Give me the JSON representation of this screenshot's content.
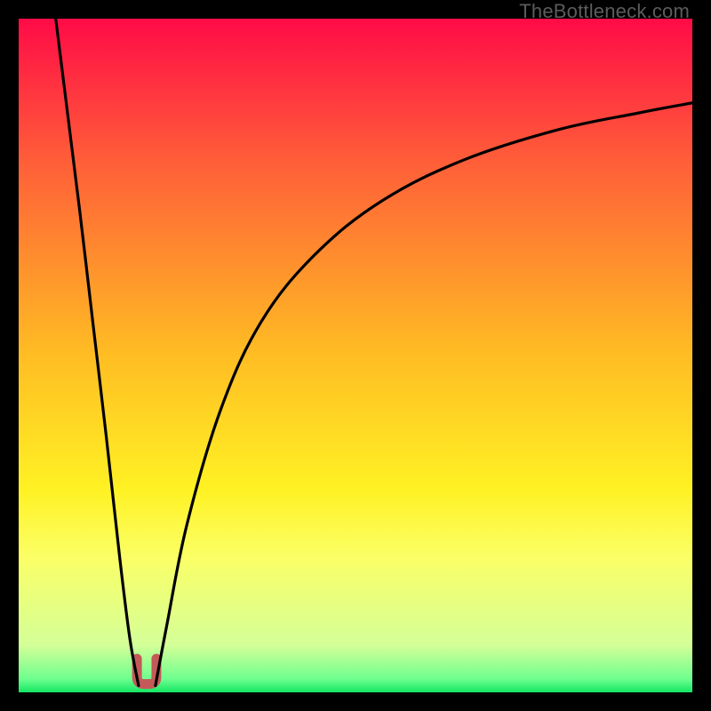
{
  "watermark": "TheBottleneck.com",
  "chart_data": {
    "type": "line",
    "title": "",
    "xlabel": "",
    "ylabel": "",
    "xlim": [
      0,
      100
    ],
    "ylim": [
      0,
      100
    ],
    "grid": false,
    "background": {
      "bands": [
        {
          "y0": 78,
          "y1": 100,
          "c0": "#ff0b47",
          "c1": "#ff6138"
        },
        {
          "y0": 50,
          "y1": 78,
          "c0": "#ff6138",
          "c1": "#ffbd23"
        },
        {
          "y0": 30,
          "y1": 50,
          "c0": "#ffbd23",
          "c1": "#fff224"
        },
        {
          "y0": 20,
          "y1": 30,
          "c0": "#fff224",
          "c1": "#fbff66"
        },
        {
          "y0": 7,
          "y1": 20,
          "c0": "#fbff66",
          "c1": "#d4ff98"
        },
        {
          "y0": 2,
          "y1": 7,
          "c0": "#d4ff98",
          "c1": "#6fff8f"
        },
        {
          "y0": 0,
          "y1": 2,
          "c0": "#6fff8f",
          "c1": "#14e664"
        }
      ]
    },
    "series": [
      {
        "name": "left-branch",
        "color": "#000000",
        "x": [
          5.5,
          7,
          9,
          11,
          13,
          15,
          16.5,
          17.8
        ],
        "y": [
          100,
          88,
          72,
          55,
          38,
          20,
          8,
          1
        ]
      },
      {
        "name": "right-branch",
        "color": "#000000",
        "x": [
          20.3,
          22,
          25,
          30,
          36,
          44,
          54,
          66,
          80,
          92,
          100
        ],
        "y": [
          1,
          10,
          25,
          42,
          55,
          65,
          73,
          79,
          83.5,
          86,
          87.5
        ]
      }
    ],
    "trough_marker": {
      "x": 19,
      "y": 1.5,
      "width_x": 3.2,
      "height_y": 3.5,
      "color": "#c45a58"
    }
  }
}
